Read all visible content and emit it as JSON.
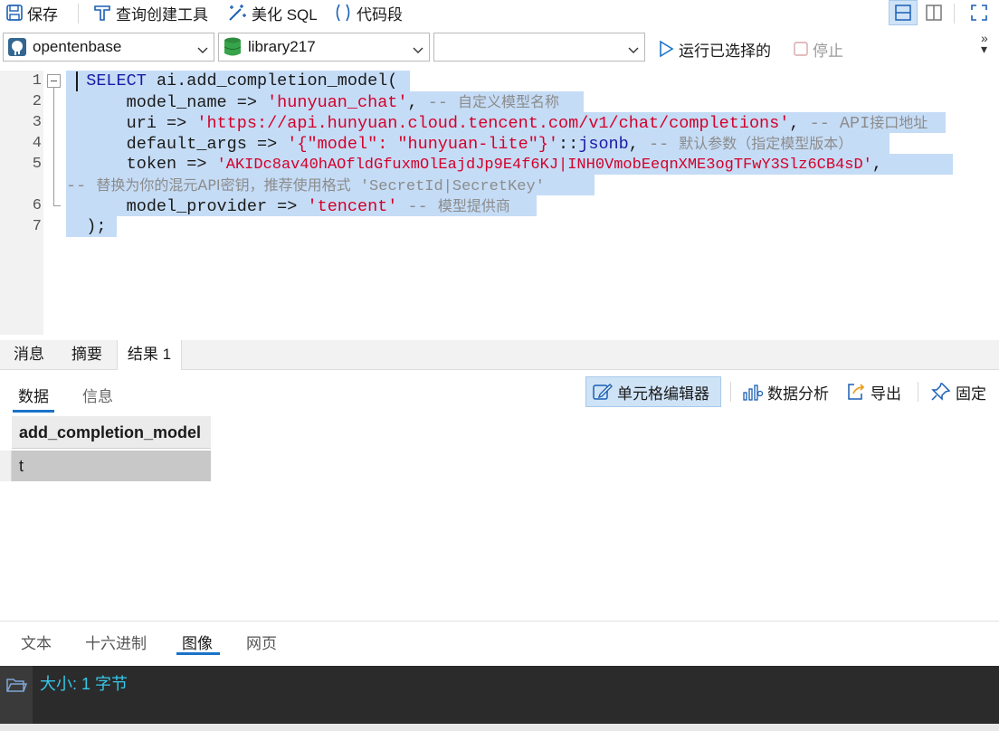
{
  "toolbar": {
    "save": "保存",
    "query_builder": "查询创建工具",
    "beautify_sql": "美化 SQL",
    "code_snippet": "代码段"
  },
  "connection": {
    "connection_name": "opentenbase",
    "database_name": "library217",
    "schema_name": "",
    "run_selected": "运行已选择的",
    "stop": "停止"
  },
  "editor": {
    "line_numbers": [
      "1",
      "2",
      "3",
      "4",
      "5",
      "6",
      "7"
    ],
    "lines": [
      {
        "kw": "SELECT",
        "rest": " ai.add_completion_model("
      },
      {
        "key": "model_name",
        "op": " => ",
        "str": "'hunyuan_chat'",
        "punct": ", ",
        "cmt_dash": "-- ",
        "cmt": "自定义模型名称"
      },
      {
        "key": "uri",
        "op": " => ",
        "str": "'https://api.hunyuan.cloud.tencent.com/v1/chat/completions'",
        "punct": ", ",
        "cmt_dash": "-- API",
        "cmt": "接口地址"
      },
      {
        "key": "default_args",
        "op": " => ",
        "str": "'{\"model\": \"hunyuan-lite\"}'",
        "cast_op": "::",
        "cast": "jsonb",
        "punct": ", ",
        "cmt_dash": "-- ",
        "cmt": "默认参数（指定模型版本）"
      },
      {
        "key": "token",
        "op": " => ",
        "str": "'AKIDc8av40hAOfldGfuxmOlEajdJp9E4f6KJ|INH0VmobEeqnXME3ogTFwY3Slz6CB4sD'",
        "punct": ","
      },
      {
        "cmt_dash": "-- ",
        "cmt_a": "替换为你的混元",
        "cmt_b": "API",
        "cmt_c": "密钥，推荐使用格式",
        "cmt_d": " 'SecretId|SecretKey'"
      },
      {
        "key": "model_provider",
        "op": " => ",
        "str": "'tencent'",
        "punct": " ",
        "cmt_dash": "-- ",
        "cmt": "模型提供商"
      },
      {
        "rest": ");"
      }
    ]
  },
  "result_tabs": [
    "消息",
    "摘要",
    "结果 1"
  ],
  "sub_tabs": [
    "数据",
    "信息"
  ],
  "actions": {
    "cell_editor": "单元格编辑器",
    "data_analysis": "数据分析",
    "export": "导出",
    "pin": "固定"
  },
  "grid": {
    "columns": [
      "add_completion_model"
    ],
    "rows": [
      [
        "t"
      ]
    ]
  },
  "viewer_tabs": [
    "文本",
    "十六进制",
    "图像",
    "网页"
  ],
  "viewer": {
    "size_text": "大小: 1 字节"
  },
  "colors": {
    "selection": "#c5dcf6",
    "keyword": "#1a1aa6",
    "string": "#d4002a",
    "comment": "#8c8c8c",
    "accent": "#1a73c8",
    "viewer_text": "#35c8ea"
  }
}
